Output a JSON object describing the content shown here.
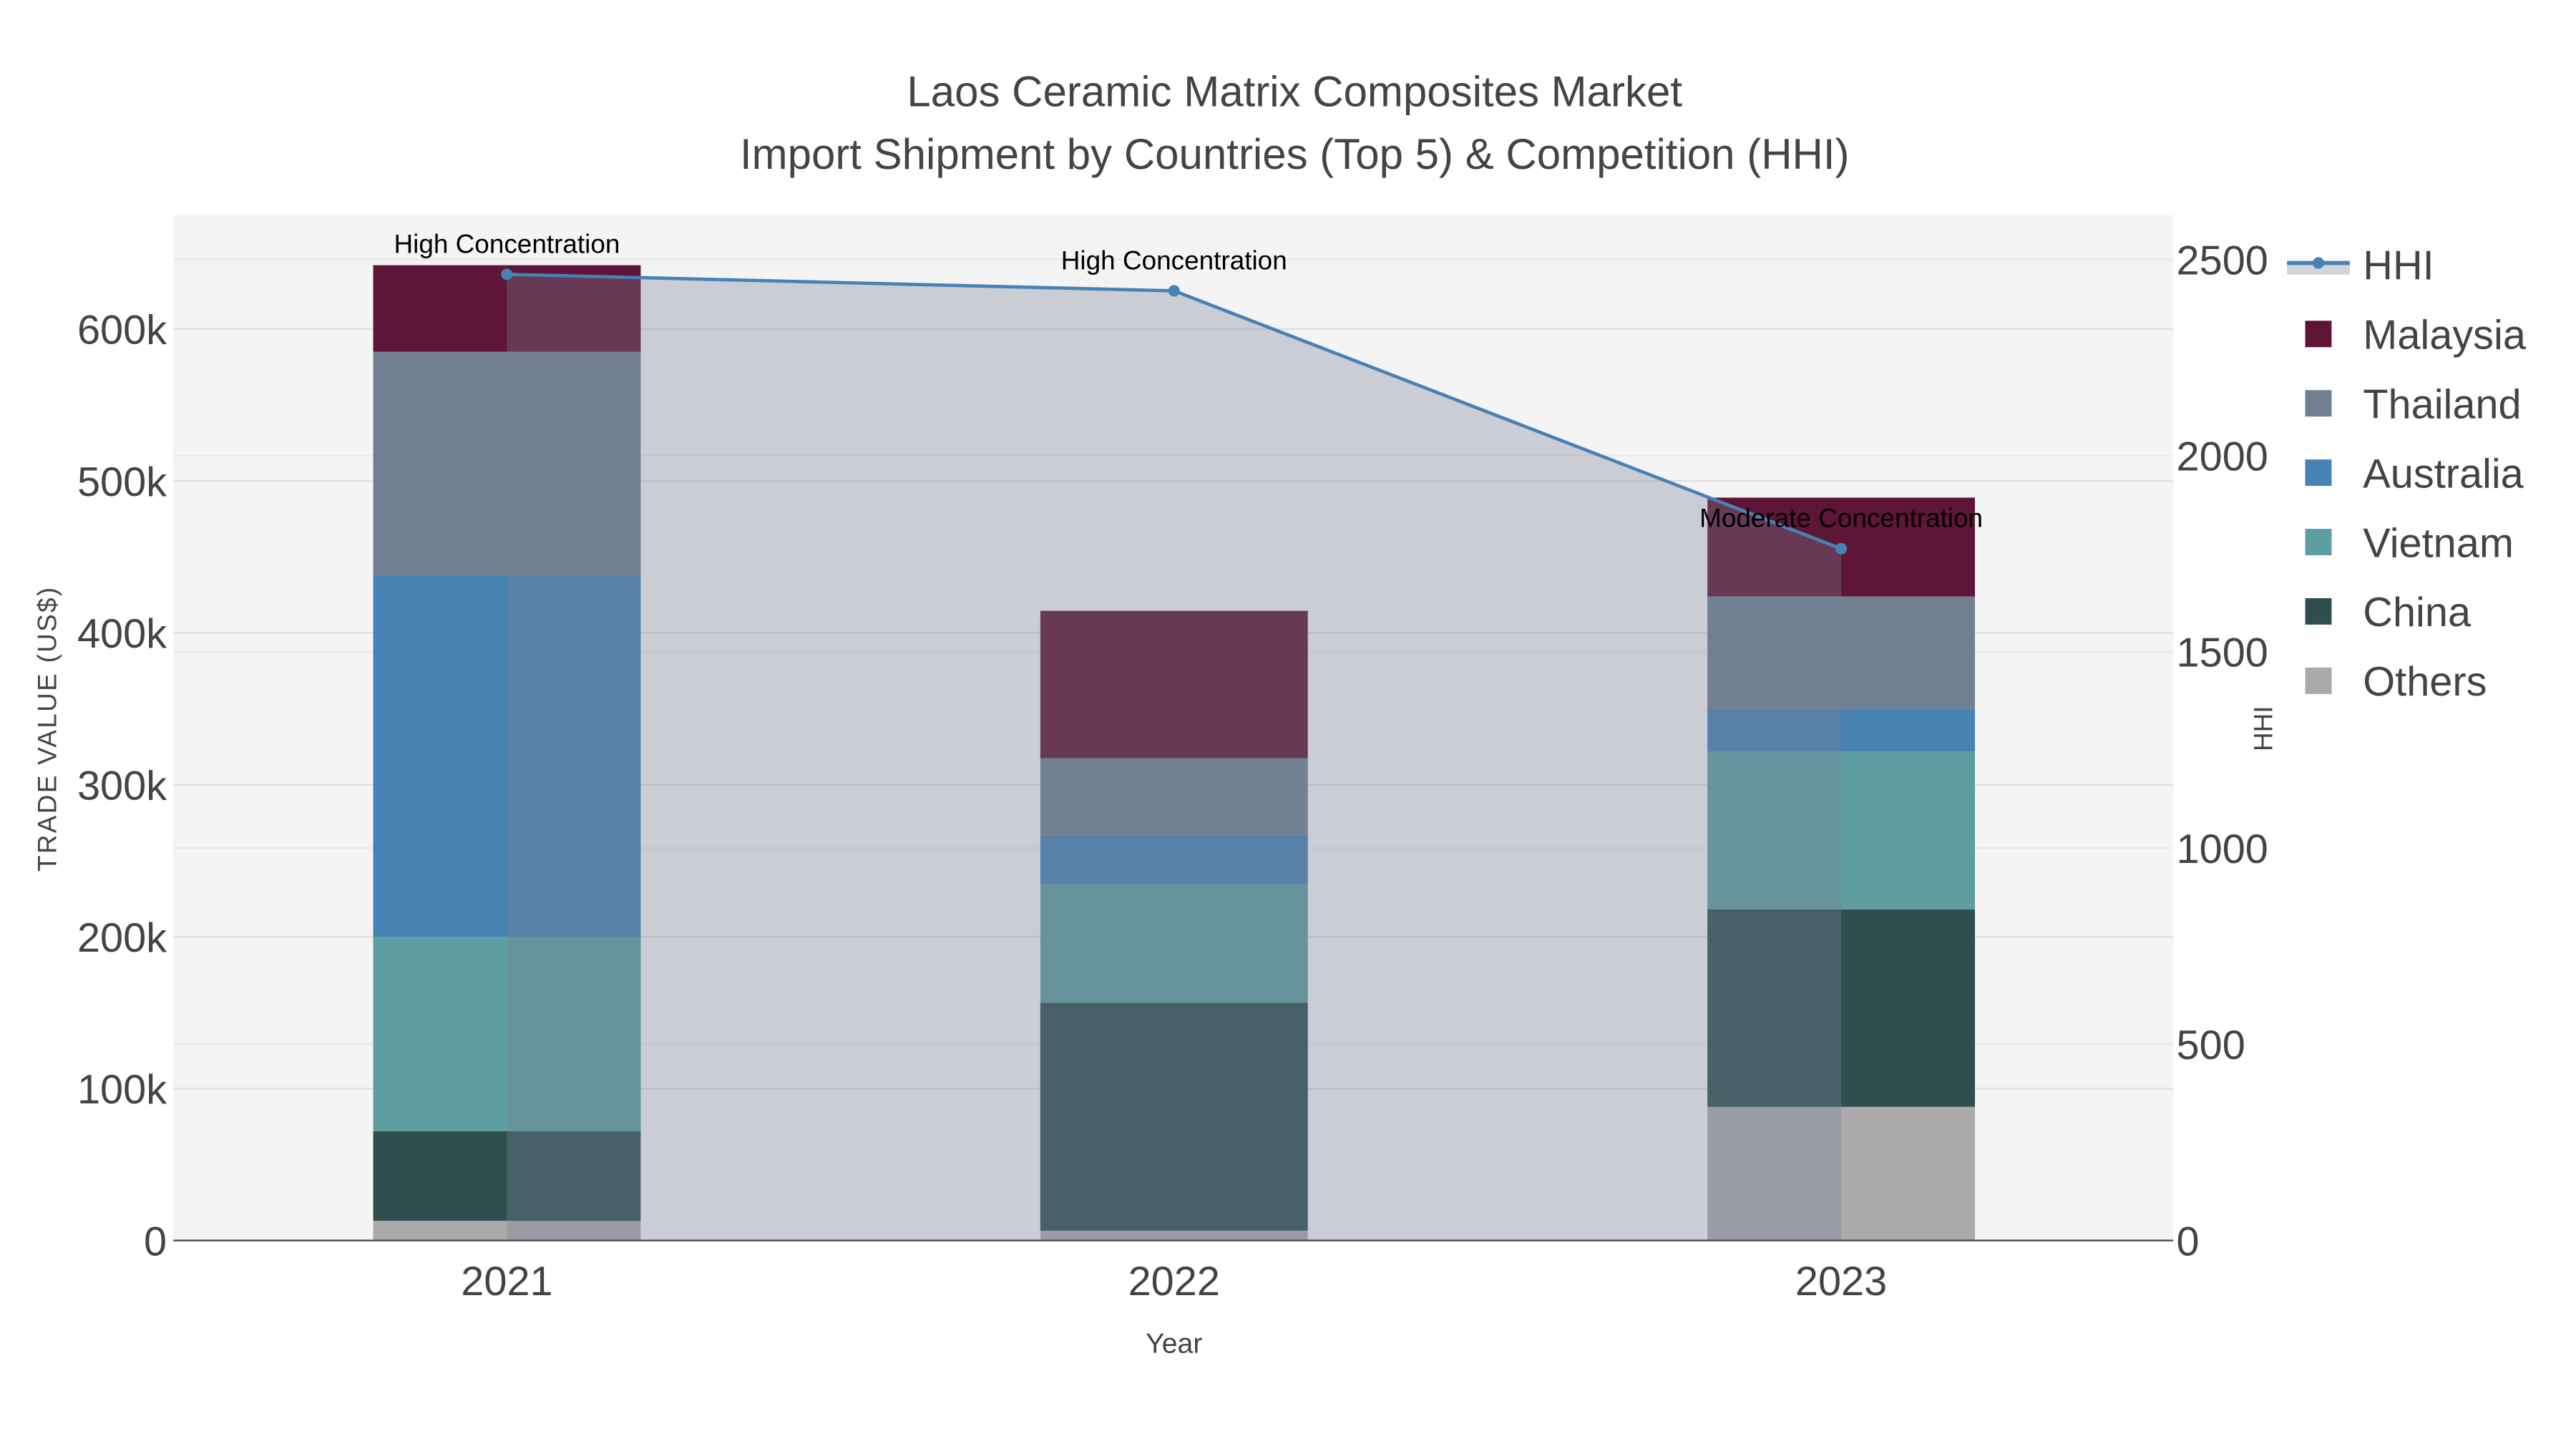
{
  "chart_data": {
    "type": "bar",
    "barmode": "stack",
    "title": "Laos Ceramic Matrix Composites Market",
    "subtitle": "Import Shipment by Countries (Top 5) & Competition (HHI)",
    "xlabel": "Year",
    "ylabel": "TRADE VALUE (US$)",
    "y2label": "HHI",
    "categories": [
      "2021",
      "2022",
      "2023"
    ],
    "ylim": [
      0,
      675000
    ],
    "y2lim": [
      0,
      2613
    ],
    "yticks": [
      0,
      100000,
      200000,
      300000,
      400000,
      500000,
      600000
    ],
    "ytick_labels": [
      "0",
      "100k",
      "200k",
      "300k",
      "400k",
      "500k",
      "600k"
    ],
    "y2ticks": [
      0,
      500,
      1000,
      1500,
      2000,
      2500
    ],
    "y2tick_labels": [
      "0",
      "500",
      "1000",
      "1500",
      "2000",
      "2500"
    ],
    "legend_position": "right",
    "series": [
      {
        "name": "Others",
        "color": "#aaaaaa",
        "values": [
          13000,
          6500,
          88000
        ]
      },
      {
        "name": "China",
        "color": "#2f4f4f",
        "values": [
          59000,
          150000,
          130000
        ]
      },
      {
        "name": "Vietnam",
        "color": "#5f9ea0",
        "values": [
          128000,
          78000,
          104000
        ]
      },
      {
        "name": "Australia",
        "color": "#4682b4",
        "values": [
          238000,
          32000,
          28000
        ]
      },
      {
        "name": "Thailand",
        "color": "#708090",
        "values": [
          147000,
          51000,
          74000
        ]
      },
      {
        "name": "Malaysia",
        "color": "#5f1535",
        "values": [
          57000,
          97000,
          65000
        ]
      }
    ],
    "line": {
      "name": "HHI",
      "color": "#4682b4",
      "values": [
        2462,
        2420,
        1763
      ]
    },
    "annotations": [
      "High Concentration",
      "High Concentration",
      "Moderate Concentration"
    ],
    "legend_order": [
      "HHI",
      "Malaysia",
      "Thailand",
      "Australia",
      "Vietnam",
      "China",
      "Others"
    ]
  }
}
